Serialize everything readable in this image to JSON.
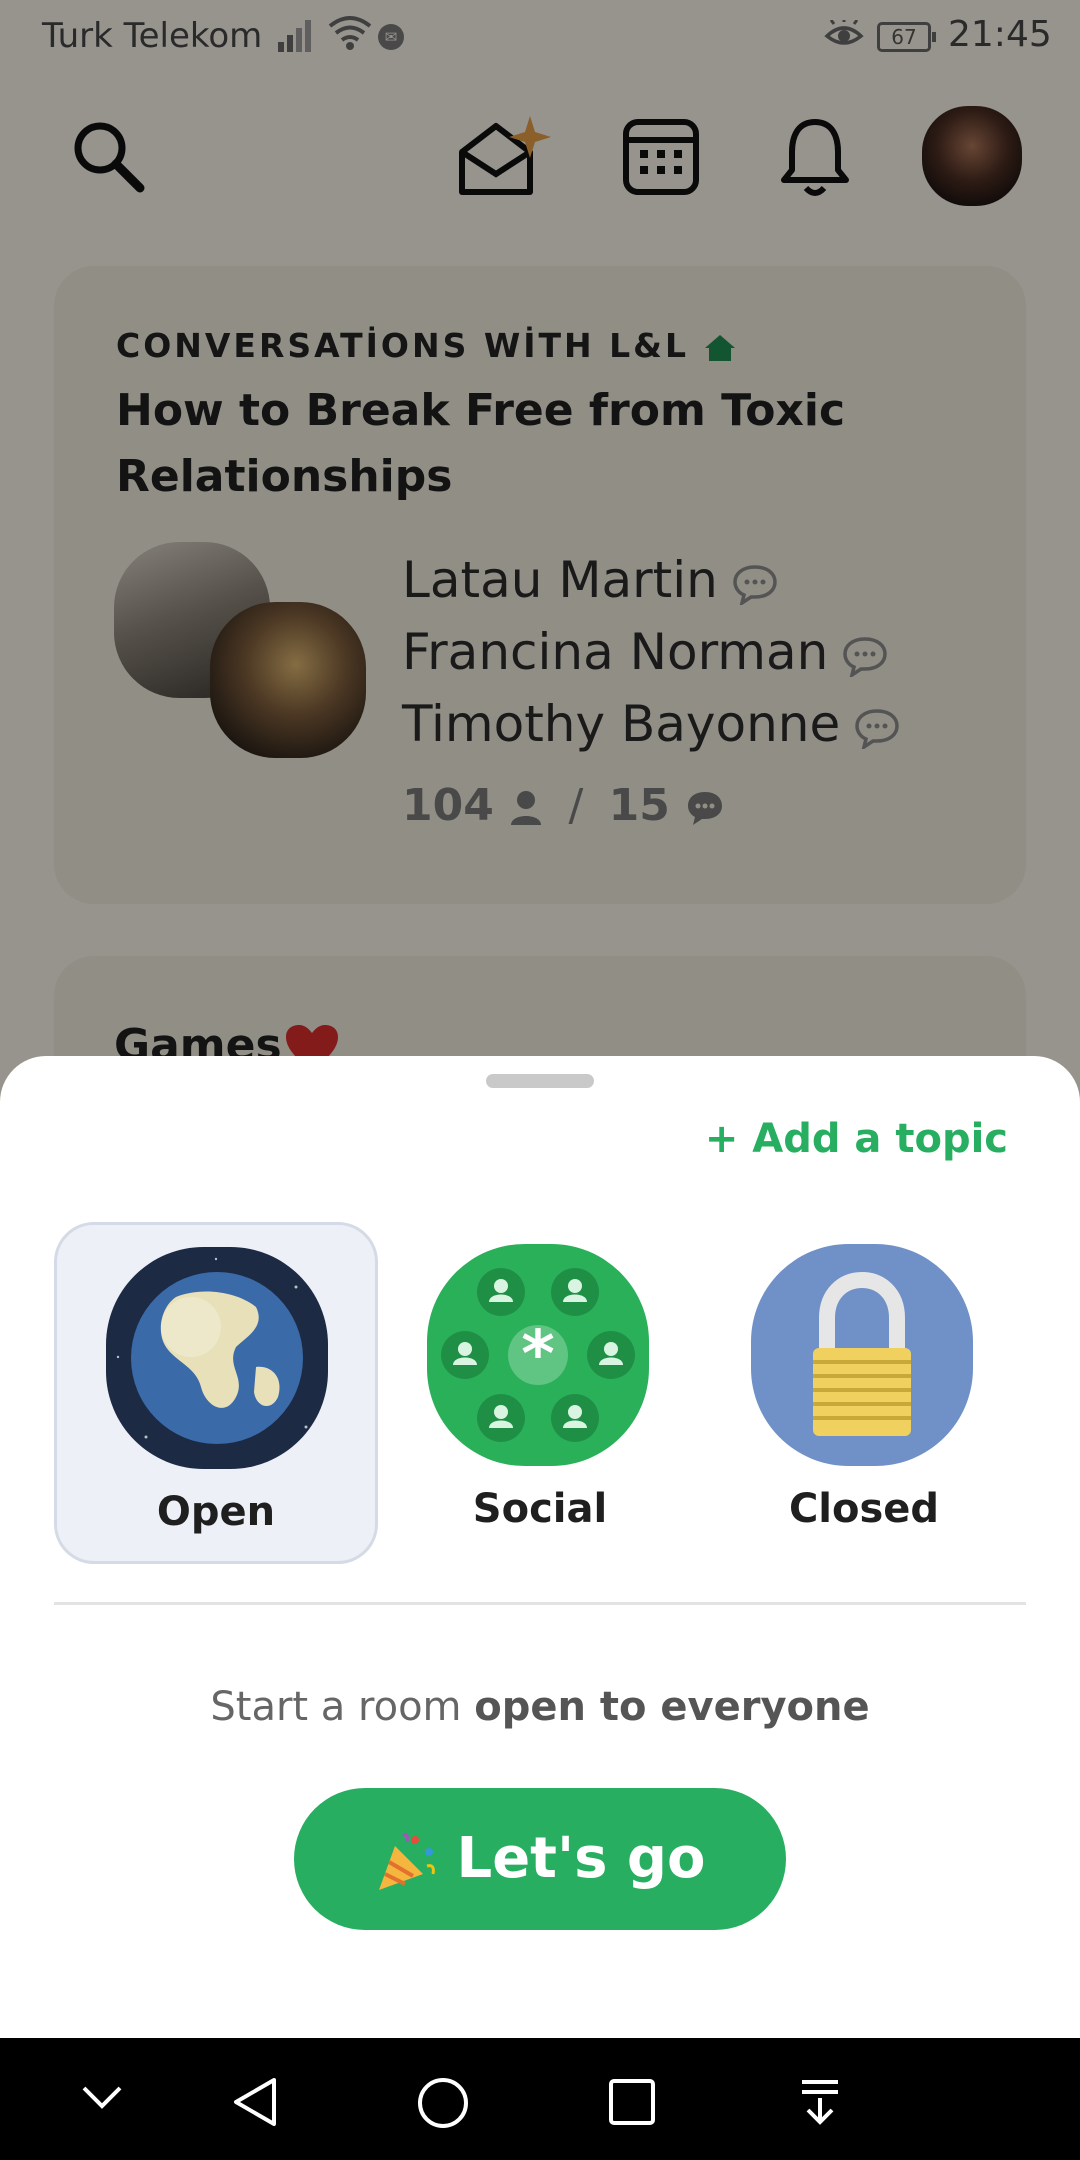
{
  "status": {
    "carrier": "Turk Telekom",
    "battery": "67",
    "time": "21:45"
  },
  "card1": {
    "club": "CONVERSATİONS WİTH L&L",
    "title": "How to Break Free from Toxic Relationships",
    "speakers": [
      "Latau Martin",
      "Francina Norman",
      "Timothy Bayonne"
    ],
    "listeners": "104",
    "speakers_count": "15"
  },
  "card2": {
    "title": "Games"
  },
  "sheet": {
    "add_topic": "+ Add a topic",
    "options": [
      {
        "label": "Open",
        "icon": "globe-icon",
        "selected": true
      },
      {
        "label": "Social",
        "icon": "social-group-icon",
        "selected": false
      },
      {
        "label": "Closed",
        "icon": "padlock-icon",
        "selected": false
      }
    ],
    "description_prefix": "Start a room ",
    "description_bold": "open to everyone",
    "button": "Let's go"
  },
  "colors": {
    "accent": "#27ae60",
    "selected_bg": "#edf0f6"
  }
}
